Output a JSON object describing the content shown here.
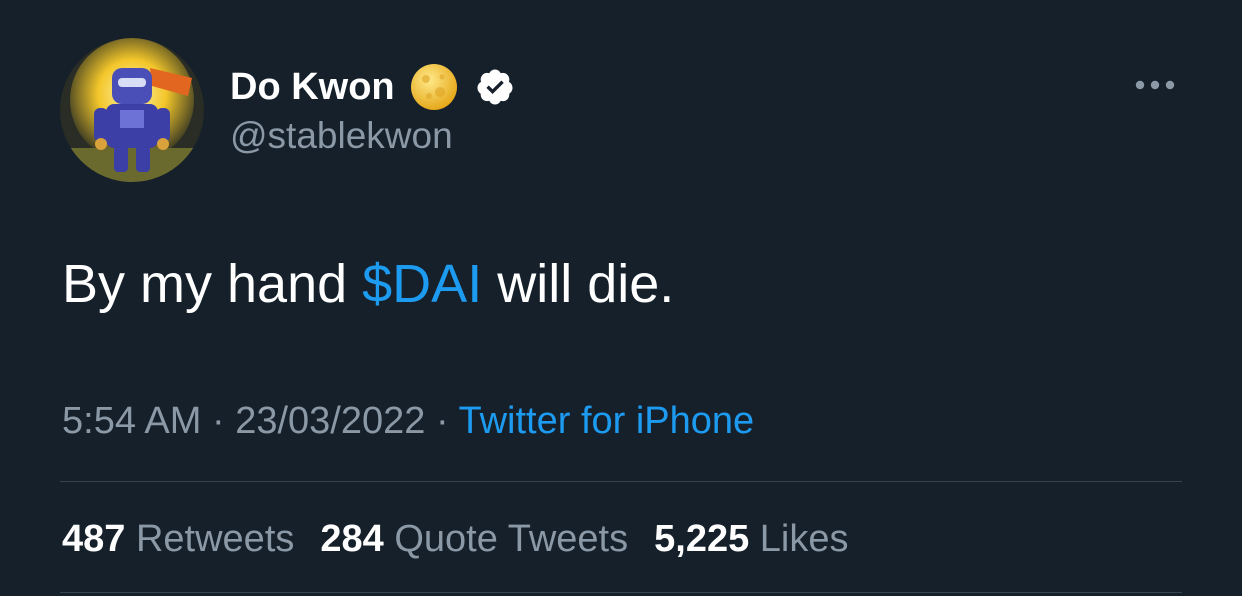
{
  "author": {
    "display_name": "Do Kwon",
    "handle": "@stablekwon",
    "badge_icon": "full-moon-emoji",
    "verified_icon": "verified-badge-icon",
    "avatar": "robot-armor-avatar"
  },
  "tweet": {
    "text_before": "By my hand ",
    "cashtag": "$DAI",
    "text_after": " will die."
  },
  "meta": {
    "time": "5:54 AM",
    "separator1": " · ",
    "date": "23/03/2022",
    "separator2": " · ",
    "source": "Twitter for iPhone"
  },
  "stats": {
    "retweets_count": "487",
    "retweets_label": "Retweets",
    "quotes_count": "284",
    "quotes_label": "Quote Tweets",
    "likes_count": "5,225",
    "likes_label": "Likes"
  },
  "colors": {
    "background": "#15202b",
    "link": "#1d9bf0",
    "secondary_text": "#8b98a5",
    "divider": "#38444d"
  },
  "more_icon": "more-horizontal-icon"
}
